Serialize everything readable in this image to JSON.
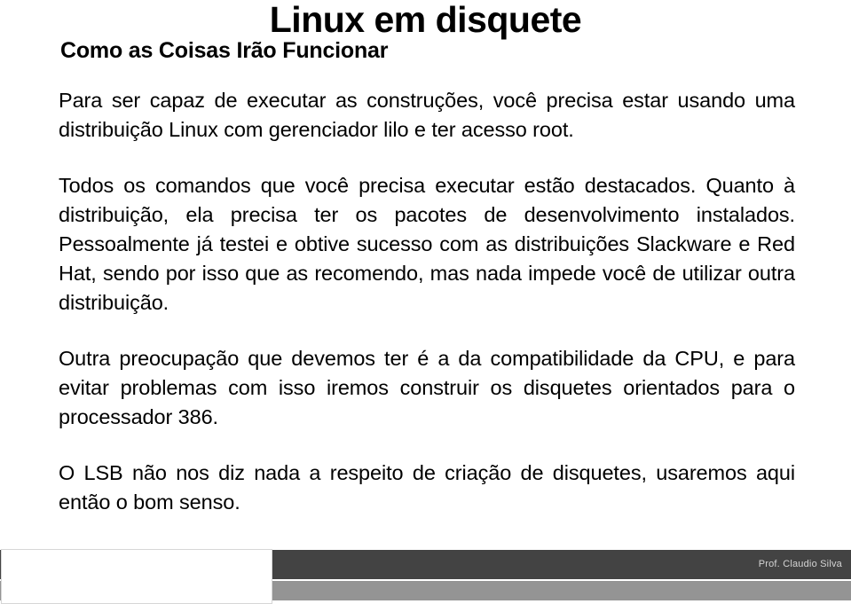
{
  "slide": {
    "title": "Linux em disquete",
    "subtitle": "Como as Coisas Irão Funcionar",
    "paragraphs": [
      "Para ser capaz de executar as construções, você precisa estar usando uma distribuição Linux com gerenciador lilo e ter acesso root.",
      "Todos os comandos que você precisa executar estão destacados. Quanto à distribuição, ela precisa ter os pacotes de desenvolvimento instalados. Pessoalmente já testei e obtive sucesso com as distribuições Slackware e Red Hat, sendo por isso que as recomendo, mas nada impede você de utilizar outra distribuição.",
      "Outra preocupação que devemos ter é a da compatibilidade da CPU, e para evitar problemas com isso iremos construir os disquetes orientados para o processador 386.",
      "O LSB não nos diz nada a respeito de criação de disquetes, usaremos aqui então o bom senso."
    ]
  },
  "footer": {
    "author": "Prof. Claudio Silva",
    "bar_dark_color": "#434343",
    "bar_light_color": "#949494",
    "author_text_color": "#d4d4d4"
  }
}
